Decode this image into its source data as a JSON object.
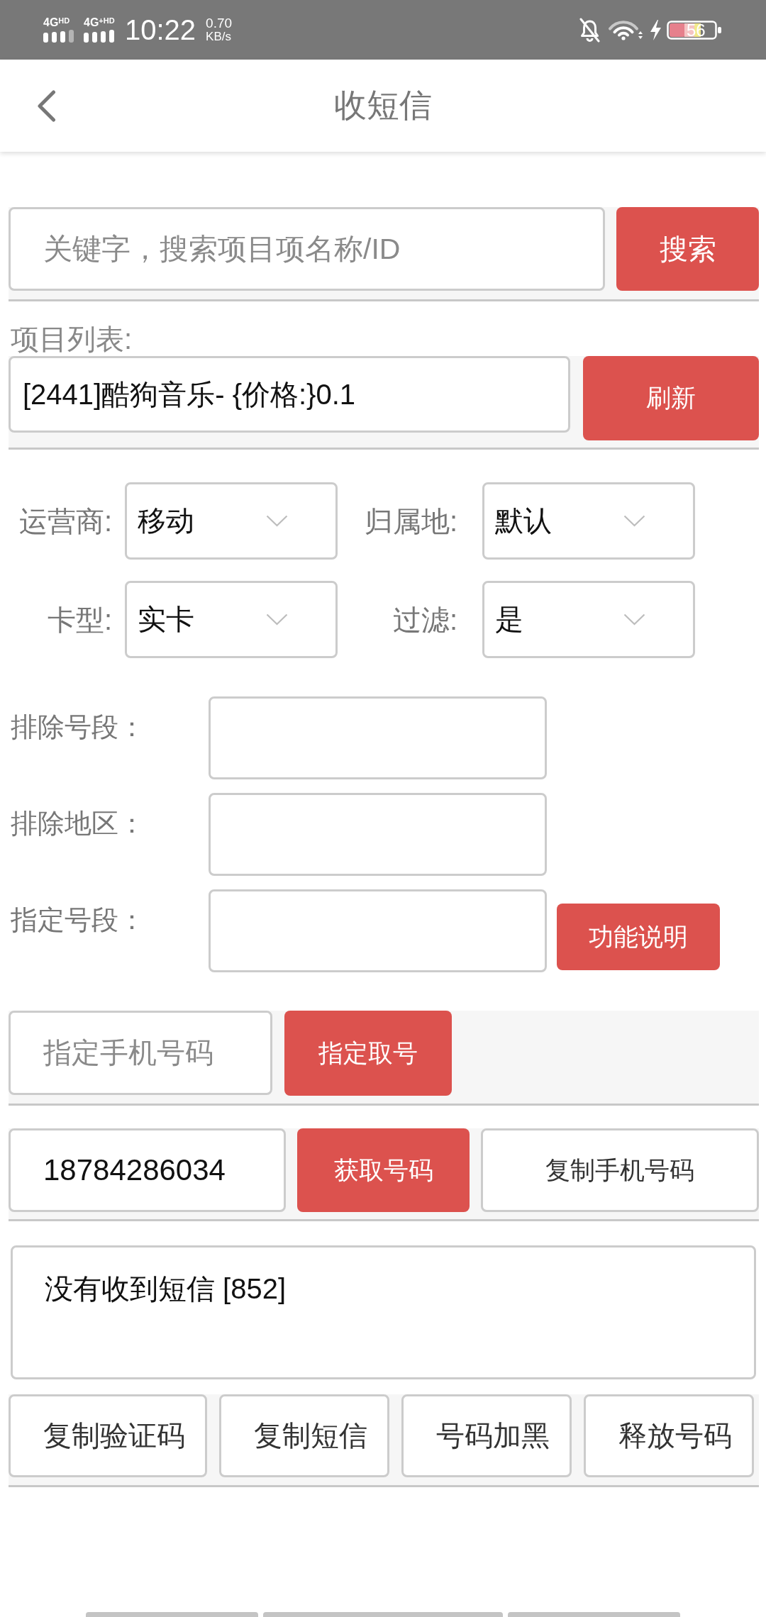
{
  "status_bar": {
    "networks": [
      "4G$^{HD}$",
      "4G$^{+HD}$"
    ],
    "time": "10:22",
    "speed": "0.70",
    "speed_unit": "KB/s",
    "battery": "56"
  },
  "header": {
    "title": "收短信"
  },
  "search": {
    "placeholder": "关键字，搜索项目项名称/ID",
    "button": "搜索"
  },
  "project": {
    "label": "项目列表:",
    "value": "[2441]酷狗音乐- {价格:}0.1",
    "button": "刷新"
  },
  "filters": [
    {
      "label": "运营商:",
      "value": "移动"
    },
    {
      "label": "归属地:",
      "value": "默认"
    },
    {
      "label": "卡型:",
      "value": "实卡"
    },
    {
      "label": "过滤:",
      "value": "是"
    }
  ],
  "segments": [
    {
      "label": "排除号段："
    },
    {
      "label": "排除地区："
    },
    {
      "label": "指定号段：",
      "button": "功能说明"
    }
  ],
  "specify": {
    "placeholder": "指定手机号码",
    "button": "指定取号"
  },
  "number": {
    "value": "18784286034",
    "buttons": [
      {
        "label": "获取号码",
        "kind": "primary"
      },
      {
        "label": "复制手机号码",
        "kind": "outline"
      }
    ]
  },
  "message": {
    "text": "没有收到短信 [852]"
  },
  "actions": [
    "复制验证码",
    "复制短信",
    "号码加黑",
    "释放号码"
  ]
}
